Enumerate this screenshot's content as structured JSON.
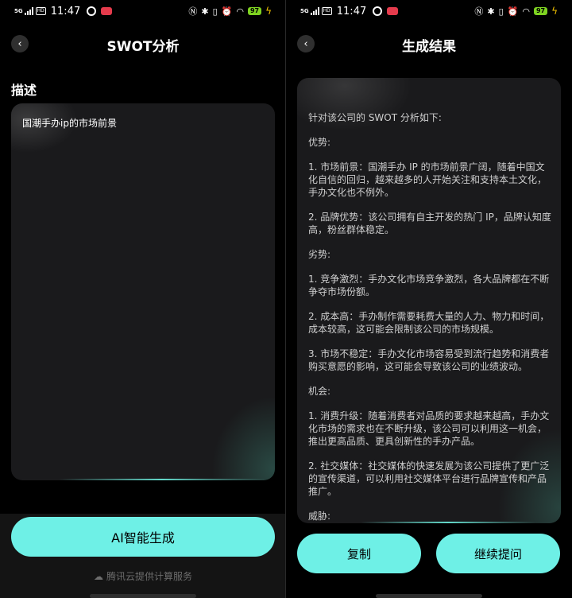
{
  "status": {
    "network": "5G",
    "hd": "HD",
    "time": "11:47",
    "battery": "97"
  },
  "left": {
    "title": "SWOT分析",
    "desc_label": "描述",
    "desc_value": "国潮手办ip的市场前景",
    "generate_button": "AI智能生成",
    "provider": "腾讯云提供计算服务"
  },
  "right": {
    "title": "生成结果",
    "result_paragraphs": [
      "针对该公司的 SWOT 分析如下:",
      "优势:",
      "1. 市场前景：国潮手办 IP 的市场前景广阔，随着中国文化自信的回归，越来越多的人开始关注和支持本土文化，手办文化也不例外。",
      "2. 品牌优势：该公司拥有自主开发的热门 IP，品牌认知度高，粉丝群体稳定。",
      "劣势:",
      "1. 竞争激烈：手办文化市场竞争激烈，各大品牌都在不断争夺市场份额。",
      "2. 成本高：手办制作需要耗费大量的人力、物力和时间，成本较高，这可能会限制该公司的市场规模。",
      "3. 市场不稳定：手办文化市场容易受到流行趋势和消费者购买意愿的影响，这可能会导致该公司的业绩波动。",
      "机会:",
      "1. 消费升级：随着消费者对品质的要求越来越高，手办文化市场的需求也在不断升级，该公司可以利用这一机会，推出更高品质、更具创新性的手办产品。",
      "2. 社交媒体：社交媒体的快速发展为该公司提供了更广泛的宣传渠道，可以利用社交媒体平台进行品牌宣传和产品推广。",
      "威胁:"
    ],
    "copy_button": "复制",
    "ask_button": "继续提问"
  }
}
